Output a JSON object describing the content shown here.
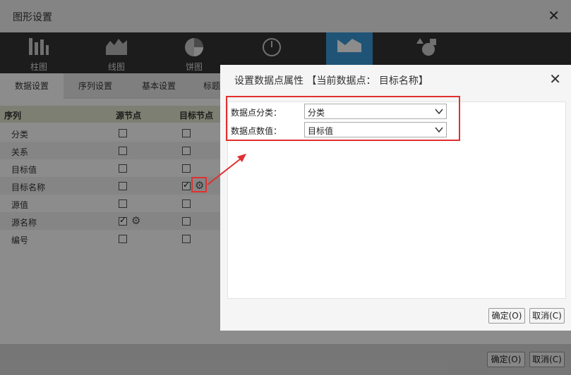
{
  "outer": {
    "title": "图形设置",
    "close": "✕",
    "chart_types": [
      {
        "label": "柱图",
        "icon": "bar-chart-icon",
        "active": false
      },
      {
        "label": "线图",
        "icon": "area-chart-icon",
        "active": false
      },
      {
        "label": "饼图",
        "icon": "pie-chart-icon",
        "active": false
      },
      {
        "label": "",
        "icon": "gauge-icon",
        "active": false
      },
      {
        "label": "",
        "icon": "map-icon",
        "active": true
      },
      {
        "label": "",
        "icon": "shapes-icon",
        "active": false
      }
    ],
    "tabs": [
      "数据设置",
      "序列设置",
      "基本设置",
      "标题"
    ],
    "table": {
      "headers": [
        "序列",
        "源节点",
        "目标节点"
      ],
      "rows": [
        {
          "name": "分类",
          "src": false,
          "dst": false
        },
        {
          "name": "关系",
          "src": false,
          "dst": false
        },
        {
          "name": "目标值",
          "src": false,
          "dst": false
        },
        {
          "name": "目标名称",
          "src": false,
          "dst": true
        },
        {
          "name": "源值",
          "src": false,
          "dst": false
        },
        {
          "name": "源名称",
          "src": true,
          "dst": false
        },
        {
          "name": "编号",
          "src": false,
          "dst": false
        }
      ]
    },
    "ok_label": "确定(O)",
    "cancel_label": "取消(C)"
  },
  "inner": {
    "title": "设置数据点属性 【当前数据点： 目标名称】",
    "close": "✕",
    "fields": [
      {
        "label": "数据点分类：",
        "value": "分类"
      },
      {
        "label": "数据点数值：",
        "value": "目标值"
      }
    ],
    "ok_label": "确定(O)",
    "cancel_label": "取消(C)"
  },
  "colors": {
    "accent": "#3a9ad9",
    "highlight": "#e03030"
  }
}
